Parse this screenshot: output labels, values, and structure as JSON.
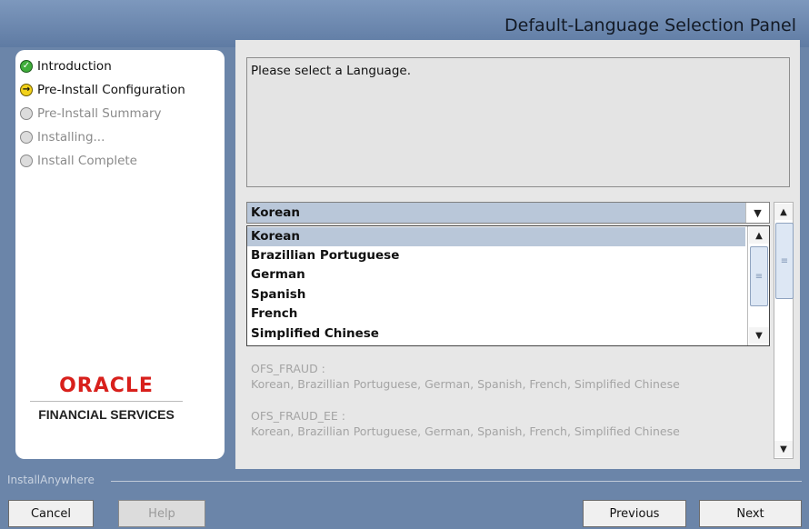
{
  "header": {
    "title": "Default-Language Selection Panel"
  },
  "steps": [
    {
      "label": "Introduction",
      "state": "done"
    },
    {
      "label": "Pre-Install Configuration",
      "state": "current"
    },
    {
      "label": "Pre-Install Summary",
      "state": "pending"
    },
    {
      "label": "Installing...",
      "state": "pending"
    },
    {
      "label": "Install Complete",
      "state": "pending"
    }
  ],
  "logo": {
    "brand": "ORACLE",
    "sub": "FINANCIAL SERVICES"
  },
  "content": {
    "message": "Please select a  Language.",
    "combo_value": "Korean",
    "options": [
      "Korean",
      "Brazillian Portuguese",
      "German",
      "Spanish",
      "French",
      "Simplified Chinese"
    ],
    "summary": [
      {
        "product": "OFS_FRAUD :",
        "languages": "Korean, Brazillian Portuguese, German, Spanish, French, Simplified Chinese"
      },
      {
        "product": "OFS_FRAUD_EE :",
        "languages": "Korean, Brazillian Portuguese, German, Spanish, French, Simplified Chinese"
      }
    ]
  },
  "footer": {
    "brand": "InstallAnywhere",
    "cancel": "Cancel",
    "help": "Help",
    "previous": "Previous",
    "next": "Next"
  },
  "colors": {
    "accent": "#b9c7d9",
    "background": "#6b85a9",
    "oracle_red": "#d8201c"
  },
  "icons": {
    "done": "check-circle-icon",
    "current": "arrow-circle-icon",
    "pending": "empty-circle-icon"
  }
}
